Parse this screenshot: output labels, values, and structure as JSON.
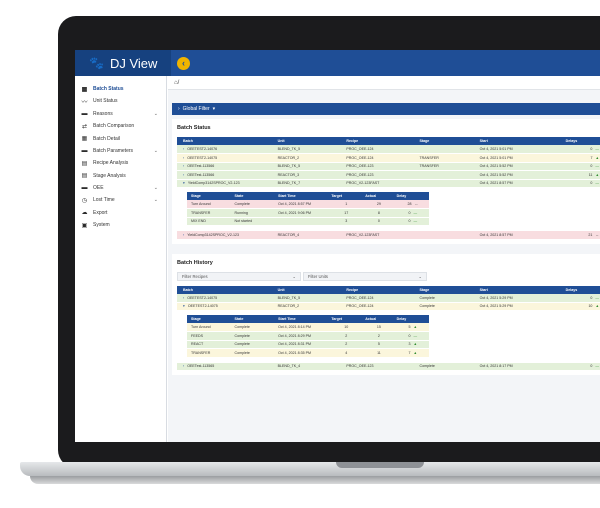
{
  "app": {
    "title": "DJ View",
    "collapse_icon": "chevron-left-icon",
    "accent": "#1f4e96",
    "highlight": "#f0b400"
  },
  "breadcrumb": {
    "home_icon": "home-icon",
    "separator": "/"
  },
  "sidebar": {
    "items": [
      {
        "label": "Batch Status",
        "icon": "grid-icon",
        "active": true,
        "expandable": false
      },
      {
        "label": "Unit Status",
        "icon": "trend-icon",
        "active": false,
        "expandable": false
      },
      {
        "label": "Reasons",
        "icon": "folder-icon",
        "active": false,
        "expandable": true
      },
      {
        "label": "Batch Comparison",
        "icon": "compare-icon",
        "active": false,
        "expandable": false
      },
      {
        "label": "Batch Detail",
        "icon": "grid-icon",
        "active": false,
        "expandable": false
      },
      {
        "label": "Batch Parameters",
        "icon": "folder-icon",
        "active": false,
        "expandable": true
      },
      {
        "label": "Recipe Analysis",
        "icon": "chart-icon",
        "active": false,
        "expandable": false
      },
      {
        "label": "Stage Analysis",
        "icon": "chart-icon",
        "active": false,
        "expandable": false
      },
      {
        "label": "OEE",
        "icon": "folder-icon",
        "active": false,
        "expandable": true
      },
      {
        "label": "Lost Time",
        "icon": "clock-icon",
        "active": false,
        "expandable": true
      },
      {
        "label": "Export",
        "icon": "cloud-icon",
        "active": false,
        "expandable": false
      },
      {
        "label": "System",
        "icon": "settings-icon",
        "active": false,
        "expandable": false
      }
    ]
  },
  "global_filter": {
    "label": "Global Filter"
  },
  "batch_status": {
    "title": "Batch Status",
    "columns": [
      "Batch",
      "Unit",
      "Recipe",
      "Stage",
      "Start",
      "Delays"
    ],
    "rows": [
      {
        "batch": "OEETEST2-14076",
        "unit": "BLEND_TK_5",
        "recipe": "PROC_OEE-124",
        "stage": "",
        "start": "Oct 4, 2021 5:01 PM",
        "delays": "0",
        "color": "green"
      },
      {
        "batch": "OEETEST2-14075",
        "unit": "REACTOR_2",
        "recipe": "PROC_OEE-124",
        "stage": "TRANSFER",
        "start": "Oct 4, 2021 5:01 PM",
        "delays": "7",
        "color": "yellow"
      },
      {
        "batch": "OEETest-113566",
        "unit": "BLEND_TK_5",
        "recipe": "PROC_OEE-123",
        "stage": "TRANSFER",
        "start": "Oct 4, 2021 5:52 PM",
        "delays": "0",
        "color": "green"
      },
      {
        "batch": "OEETest-113566",
        "unit": "REACTOR_3",
        "recipe": "PROC_OEE-123",
        "stage": "",
        "start": "Oct 4, 2021 5:52 PM",
        "delays": "11",
        "color": "green"
      },
      {
        "batch": "YieldComp3142SPROC_V2-123",
        "unit": "BLEND_TK_7",
        "recipe": "PROC_V2-123FAST",
        "stage": "",
        "start": "Oct 4, 2021 8:57 PM",
        "delays": "0",
        "color": "green",
        "expanded": true
      }
    ],
    "nested": {
      "columns": [
        "Stage",
        "State",
        "Start Time",
        "Target",
        "Actual",
        "Delay"
      ],
      "rows": [
        {
          "stage": "Turn Around",
          "state": "Complete",
          "start": "Oct 4, 2021 8:57 PM",
          "target": "1",
          "actual": "29",
          "delay": "28",
          "color": "pink",
          "ind": "↔"
        },
        {
          "stage": "TRANSFER",
          "state": "Running",
          "start": "Oct 4, 2021 9:06 PM",
          "target": "17",
          "actual": "8",
          "delay": "0",
          "color": "green",
          "ind": ""
        },
        {
          "stage": "MIX END",
          "state": "Not started",
          "start": "",
          "target": "3",
          "actual": "0",
          "delay": "0",
          "color": "green",
          "ind": ""
        }
      ]
    },
    "last_row": {
      "batch": "YieldComp3142SPROC_V2-123",
      "unit": "REACTOR_4",
      "recipe": "PROC_V2-123FAST",
      "stage": "",
      "start": "Oct 4, 2021 8:57 PM",
      "delays": "21",
      "color": "pink"
    }
  },
  "batch_history": {
    "title": "Batch History",
    "filter_recipes": "Filter Recipes",
    "filter_units": "Filter Units",
    "columns": [
      "Batch",
      "Unit",
      "Recipe",
      "Stage",
      "Start",
      "Delays"
    ],
    "rows": [
      {
        "batch": "OEETEST2-14075",
        "unit": "BLEND_TK_5",
        "recipe": "PROC_OEE-124",
        "stage": "Complete",
        "start": "Oct 4, 2021 5:29 PM",
        "delays": "0",
        "color": "green"
      },
      {
        "batch": "OEETEST2-14075",
        "unit": "REACTOR_2",
        "recipe": "PROC_OEE-124",
        "stage": "Complete",
        "start": "Oct 4, 2021 5:29 PM",
        "delays": "10",
        "color": "yellow",
        "expanded": true
      }
    ],
    "nested": {
      "columns": [
        "Stage",
        "State",
        "Start Time",
        "Target",
        "Actual",
        "Delay"
      ],
      "rows": [
        {
          "stage": "Turn Around",
          "state": "Complete",
          "start": "Oct 4, 2021 8:14 PM",
          "target": "10",
          "actual": "15",
          "delay": "5",
          "color": "yellow"
        },
        {
          "stage": "FEEDS",
          "state": "Complete",
          "start": "Oct 4, 2021 8:29 PM",
          "target": "2",
          "actual": "2",
          "delay": "0",
          "color": "green"
        },
        {
          "stage": "REACT",
          "state": "Complete",
          "start": "Oct 4, 2021 8:31 PM",
          "target": "2",
          "actual": "5",
          "delay": "3",
          "color": "green"
        },
        {
          "stage": "TRANSFER",
          "state": "Complete",
          "start": "Oct 4, 2021 8:35 PM",
          "target": "4",
          "actual": "11",
          "delay": "7",
          "color": "yellow"
        }
      ]
    },
    "last_row": {
      "batch": "OEETest-113565",
      "unit": "BLEND_TK_4",
      "recipe": "PROC_OEE-123",
      "stage": "Complete",
      "start": "Oct 4, 2021 8:17 PM",
      "delays": "0",
      "color": "green"
    }
  }
}
